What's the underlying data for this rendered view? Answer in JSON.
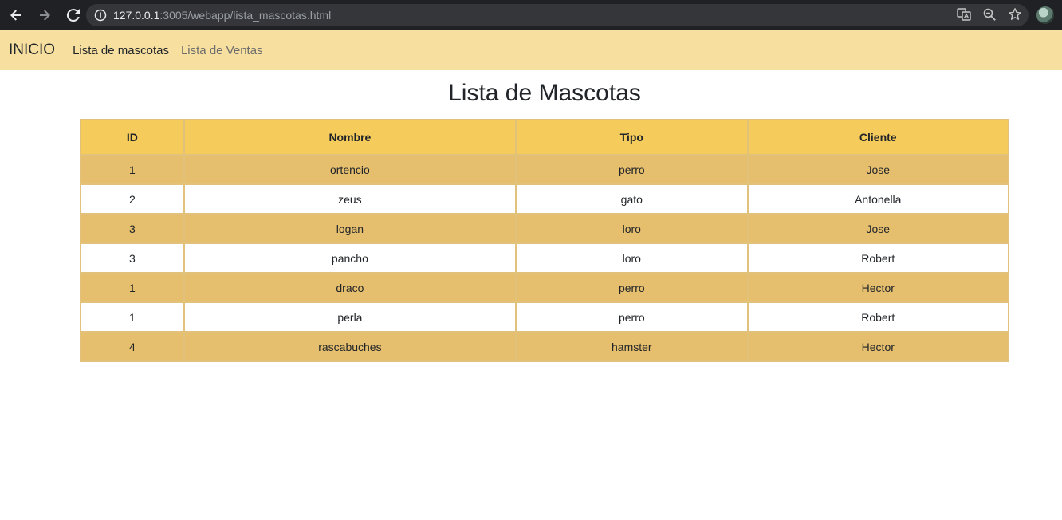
{
  "browser": {
    "url_host": "127.0.0.1",
    "url_rest": ":3005/webapp/lista_mascotas.html"
  },
  "navbar": {
    "brand": "INICIO",
    "links": [
      {
        "label": "Lista de mascotas",
        "active": true
      },
      {
        "label": "Lista de Ventas",
        "active": false
      }
    ]
  },
  "page": {
    "title": "Lista de Mascotas"
  },
  "table": {
    "headers": [
      "ID",
      "Nombre",
      "Tipo",
      "Cliente"
    ],
    "rows": [
      [
        "1",
        "ortencio",
        "perro",
        "Jose"
      ],
      [
        "2",
        "zeus",
        "gato",
        "Antonella"
      ],
      [
        "3",
        "logan",
        "loro",
        "Jose"
      ],
      [
        "3",
        "pancho",
        "loro",
        "Robert"
      ],
      [
        "1",
        "draco",
        "perro",
        "Hector"
      ],
      [
        "1",
        "perla",
        "perro",
        "Robert"
      ],
      [
        "4",
        "rascabuches",
        "hamster",
        "Hector"
      ]
    ]
  },
  "colors": {
    "navbar_bg": "#f7df9f",
    "header_bg": "#f5cb5c",
    "row_odd_bg": "#e6bf6e",
    "row_even_bg": "#ffffff"
  },
  "icons": [
    "back-arrow-icon",
    "forward-arrow-icon",
    "reload-icon",
    "info-icon",
    "translate-icon",
    "zoom-icon",
    "star-icon",
    "profile-avatar"
  ]
}
